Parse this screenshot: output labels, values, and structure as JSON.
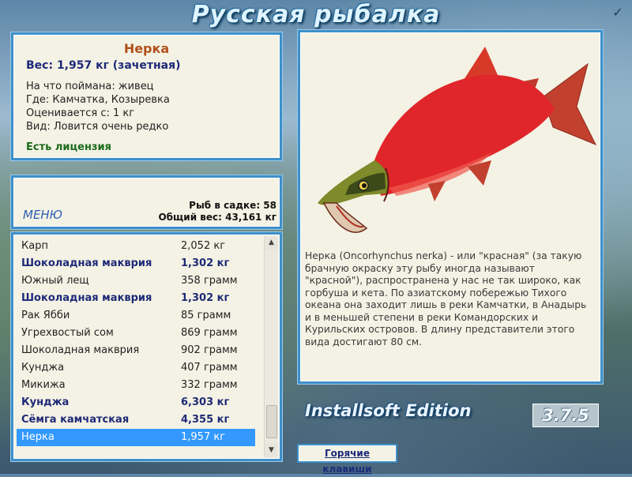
{
  "window": {
    "title": "Русская рыбалка",
    "close_glyph": "✓"
  },
  "info": {
    "fish_name": "Нерка",
    "weight_line": "Вес: 1,957 кг (зачетная)",
    "bait": "На что поймана: живец",
    "location": "Где: Камчатка, Козыревка",
    "min_weight": "Оценивается с: 1 кг",
    "rarity": "Вид: Ловится очень редко",
    "license": "Есть лицензия"
  },
  "menu": {
    "menu_label": "МЕНЮ",
    "cage_count": "Рыб в садке: 58",
    "total_weight": "Общий вес: 43,161 кг"
  },
  "catch_list": [
    {
      "name": "Карп",
      "weight": "2,052 кг",
      "bold": false,
      "selected": false
    },
    {
      "name": "Шоколадная макврия",
      "weight": "1,302 кг",
      "bold": true,
      "selected": false
    },
    {
      "name": "Южный лещ",
      "weight": "358 грамм",
      "bold": false,
      "selected": false
    },
    {
      "name": "Шоколадная макврия",
      "weight": "1,302 кг",
      "bold": true,
      "selected": false
    },
    {
      "name": "Рак Ябби",
      "weight": "85 грамм",
      "bold": false,
      "selected": false
    },
    {
      "name": "Угрехвостый сом",
      "weight": "869 грамм",
      "bold": false,
      "selected": false
    },
    {
      "name": "Шоколадная макврия",
      "weight": "902 грамм",
      "bold": false,
      "selected": false
    },
    {
      "name": "Кунджа",
      "weight": "407 грамм",
      "bold": false,
      "selected": false
    },
    {
      "name": "Микижа",
      "weight": "332 грамм",
      "bold": false,
      "selected": false
    },
    {
      "name": "Кунджа",
      "weight": "6,303 кг",
      "bold": true,
      "selected": false
    },
    {
      "name": "Сёмга камчатская",
      "weight": "4,355 кг",
      "bold": true,
      "selected": false
    },
    {
      "name": "Нерка",
      "weight": "1,957 кг",
      "bold": false,
      "selected": true
    }
  ],
  "description": "Нерка (Oncorhynchus nerka) - или \"красная\" (за такую брачную окраску эту рыбу иногда называют \"красной\"), распространена у нас не так широко, как горбуша и кета. По азиатскому побережью Тихого океана она заходит лишь в реки Камчатки, в Анадырь и в меньшей степени в реки Командорских и Курильских островов. В длину представители этого вида достигают 80 см.",
  "footer": {
    "edition": "Installsoft Edition",
    "version": "3.7.5",
    "hotkeys_label": "Горячие клавиши"
  },
  "colors": {
    "panel_border": "#3e90c9",
    "panel_bg": "#f4f2e4",
    "fish_name": "#b0501a",
    "emphasis_blue": "#1e2a78",
    "license_green": "#1b6a1b",
    "selection": "#3399ff",
    "fish_body_red": "#e0262a"
  }
}
